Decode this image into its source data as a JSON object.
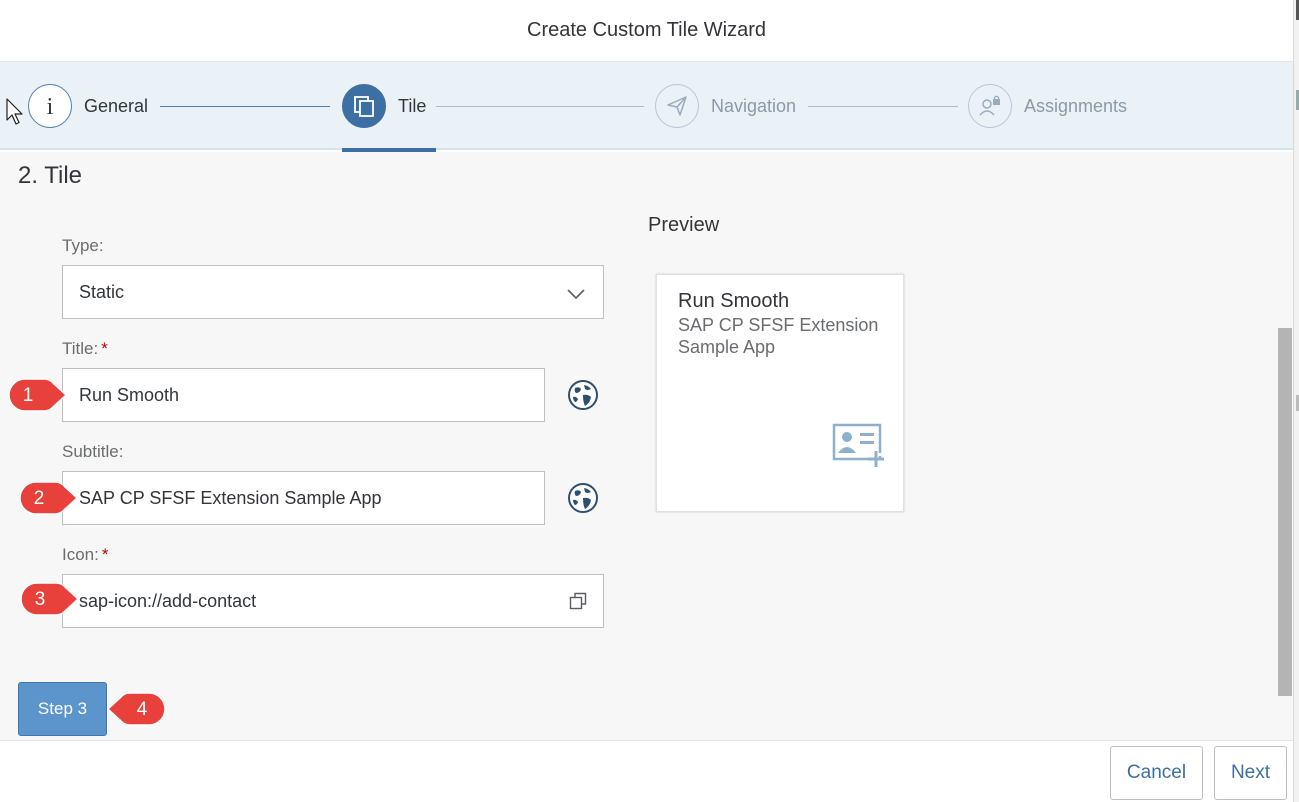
{
  "dialog": {
    "title": "Create Custom Tile Wizard"
  },
  "wizard_steps": [
    {
      "label": "General",
      "icon": "info-icon",
      "state": "completed"
    },
    {
      "label": "Tile",
      "icon": "copy-icon",
      "state": "active"
    },
    {
      "label": "Navigation",
      "icon": "paper-plane-icon",
      "state": "future"
    },
    {
      "label": "Assignments",
      "icon": "user-lock-icon",
      "state": "future"
    }
  ],
  "section": {
    "title": "2. Tile"
  },
  "form": {
    "type_label": "Type:",
    "type_value": "Static",
    "title_label": "Title:",
    "title_required_marker": "*",
    "title_value": "Run Smooth",
    "subtitle_label": "Subtitle:",
    "subtitle_value": "SAP CP SFSF Extension Sample App",
    "icon_label": "Icon:",
    "icon_required_marker": "*",
    "icon_value": "sap-icon://add-contact"
  },
  "preview": {
    "label": "Preview",
    "tile_title": "Run Smooth",
    "tile_subtitle": "SAP CP SFSF Extension Sample App",
    "tile_icon": "add-contact-icon"
  },
  "buttons": {
    "step3": "Step 3",
    "cancel": "Cancel",
    "next": "Next"
  },
  "callouts": [
    "1",
    "2",
    "3",
    "4"
  ],
  "colors": {
    "accent": "#3d6fa3",
    "step_button": "#5b95cc",
    "callout": "#e8403a",
    "required": "#bb0000"
  }
}
